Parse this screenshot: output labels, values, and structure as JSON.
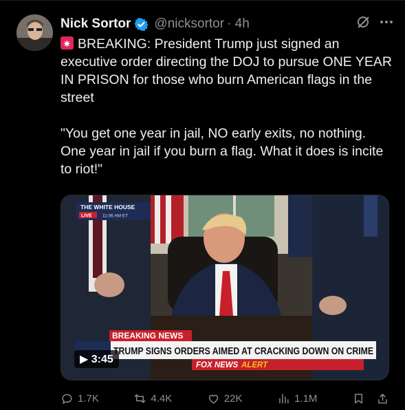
{
  "tweet": {
    "name": "Nick Sortor",
    "handle": "@nicksortor",
    "time": "· 4h",
    "text": "BREAKING: President Trump just signed an executive order directing the DOJ to pursue ONE YEAR IN PRISON for those who burn American flags in the street\n\n\"You get one year in jail, NO early exits, no nothing. One year in jail if you burn a flag. What it does is incite to riot!\""
  },
  "video": {
    "duration": "3:45",
    "bug_title": "THE WHITE HOUSE",
    "bug_live": "LIVE",
    "bug_time": "11:06 AM ET",
    "banner_top": "BREAKING NEWS",
    "banner_main": "TRUMP SIGNS ORDERS AIMED AT CRACKING DOWN ON CRIME",
    "banner_bottom_brand": "FOX NEWS",
    "banner_bottom_alert": "ALERT"
  },
  "actions": {
    "replies": "1.7K",
    "reposts": "4.4K",
    "likes": "22K",
    "views": "1.1M"
  },
  "icons": [
    "verified-icon",
    "grok-icon",
    "more-icon",
    "siren-icon",
    "reply-icon",
    "repost-icon",
    "like-icon",
    "views-icon",
    "bookmark-icon",
    "share-icon"
  ],
  "colors": {
    "verified": "#1d9bf0",
    "background": "#000000",
    "muted": "#8b9096",
    "siren": "#e0245e"
  }
}
